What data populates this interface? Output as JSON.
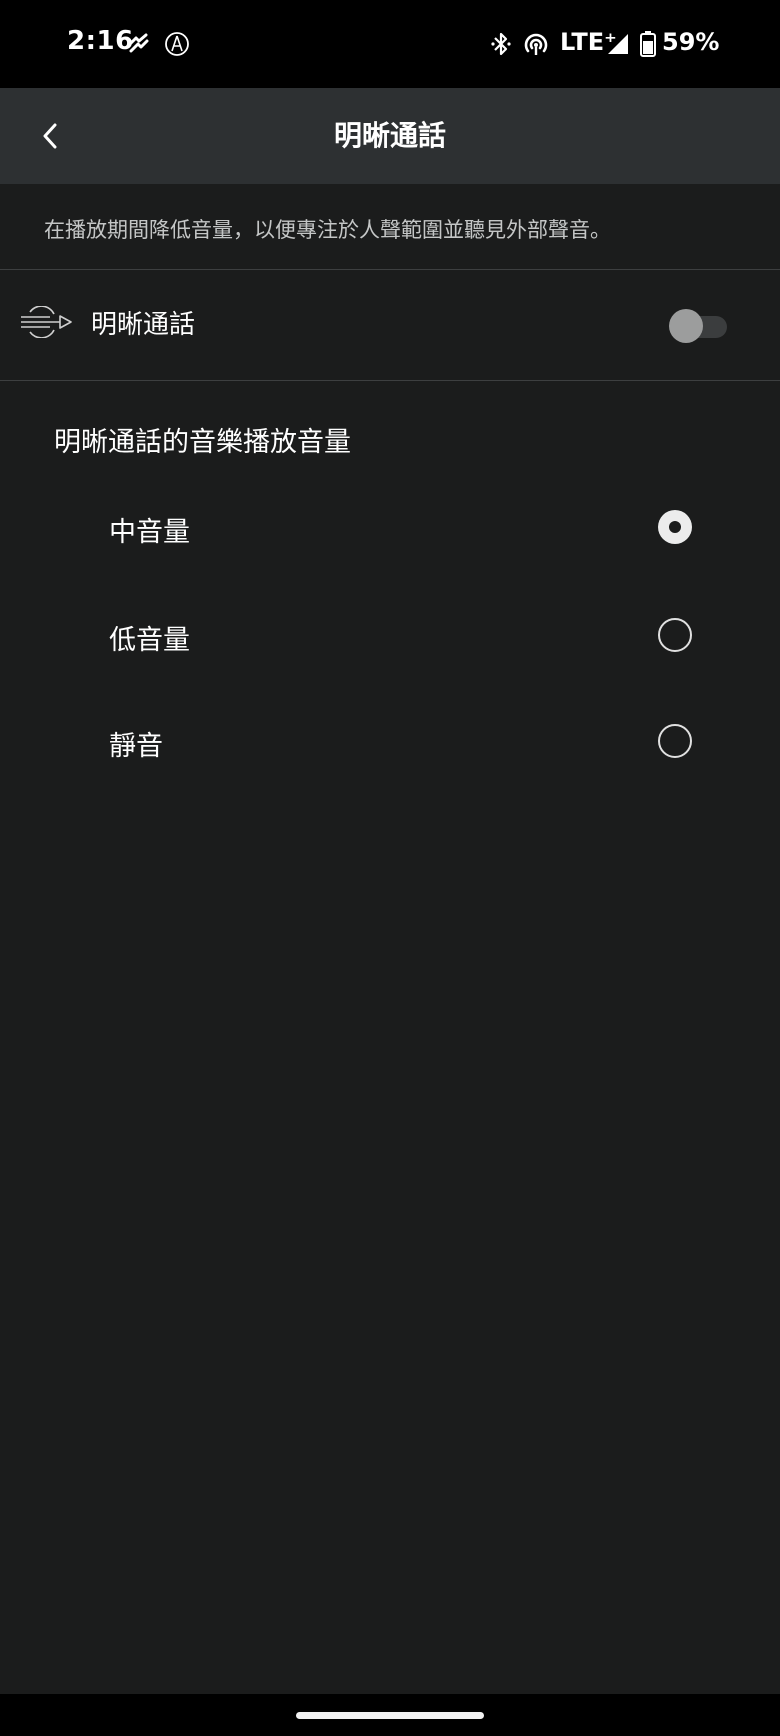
{
  "status_bar": {
    "time": "2:16",
    "network": "LTE⁺",
    "battery": "59%",
    "icons": [
      "notification-heart-icon",
      "audio-technica-icon",
      "bluetooth-icon",
      "hotspot-icon",
      "signal-icon",
      "battery-icon"
    ]
  },
  "app_bar": {
    "title": "明晰通話",
    "back_icon": "chevron-left-icon"
  },
  "description": "在播放期間降低音量，以便專注於人聲範圍並聽見外部聲音。",
  "toggle": {
    "label": "明晰通話",
    "icon": "voice-focus-icon",
    "enabled": false
  },
  "volume_section": {
    "title": "明晰通話的音樂播放音量",
    "selected": 0,
    "options": [
      {
        "label": "中音量",
        "checked": true
      },
      {
        "label": "低音量",
        "checked": false
      },
      {
        "label": "靜音",
        "checked": false
      }
    ]
  },
  "colors": {
    "status_bar": "#000000",
    "app_bar": "#2d3032",
    "background": "#1b1c1c",
    "divider": "#3d3f40"
  }
}
